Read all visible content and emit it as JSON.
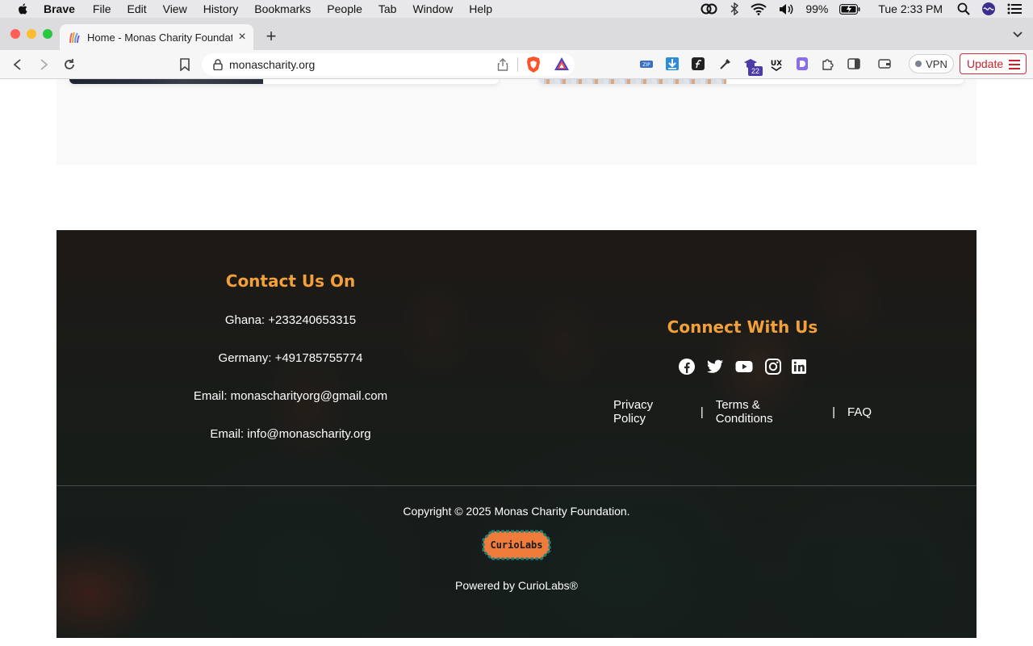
{
  "menubar": {
    "app_name": "Brave",
    "menus": [
      "File",
      "Edit",
      "View",
      "History",
      "Bookmarks",
      "People",
      "Tab",
      "Window",
      "Help"
    ],
    "battery": "99%",
    "clock": "Tue 2:33 PM"
  },
  "browser": {
    "tab_title": "Home - Monas Charity Foundation",
    "url": "monascharity.org",
    "vpn_label": "VPN",
    "update_label": "Update",
    "extension_badge": "22",
    "zip_ext_label": "ZIP",
    "ux_ext_label": "UX",
    "accent_color": "#c8232d"
  },
  "footer": {
    "contact_title": "Contact Us On",
    "contact_lines": [
      "Ghana: +233240653315",
      "Germany: +491785755774",
      "Email: monascharityorg@gmail.com",
      "Email: info@monascharity.org"
    ],
    "connect_title": "Connect With Us",
    "social_icons": [
      "facebook-icon",
      "twitter-icon",
      "youtube-icon",
      "instagram-icon",
      "linkedin-icon"
    ],
    "links": [
      "Privacy Policy",
      "Terms & Conditions",
      "FAQ"
    ],
    "link_divider": "|",
    "copyright": "Copyright © 2025 Monas Charity Foundation.",
    "logo_text": "CurioLabs",
    "powered_by": "Powered by CurioLabs®",
    "heading_color": "#f2a03a"
  }
}
